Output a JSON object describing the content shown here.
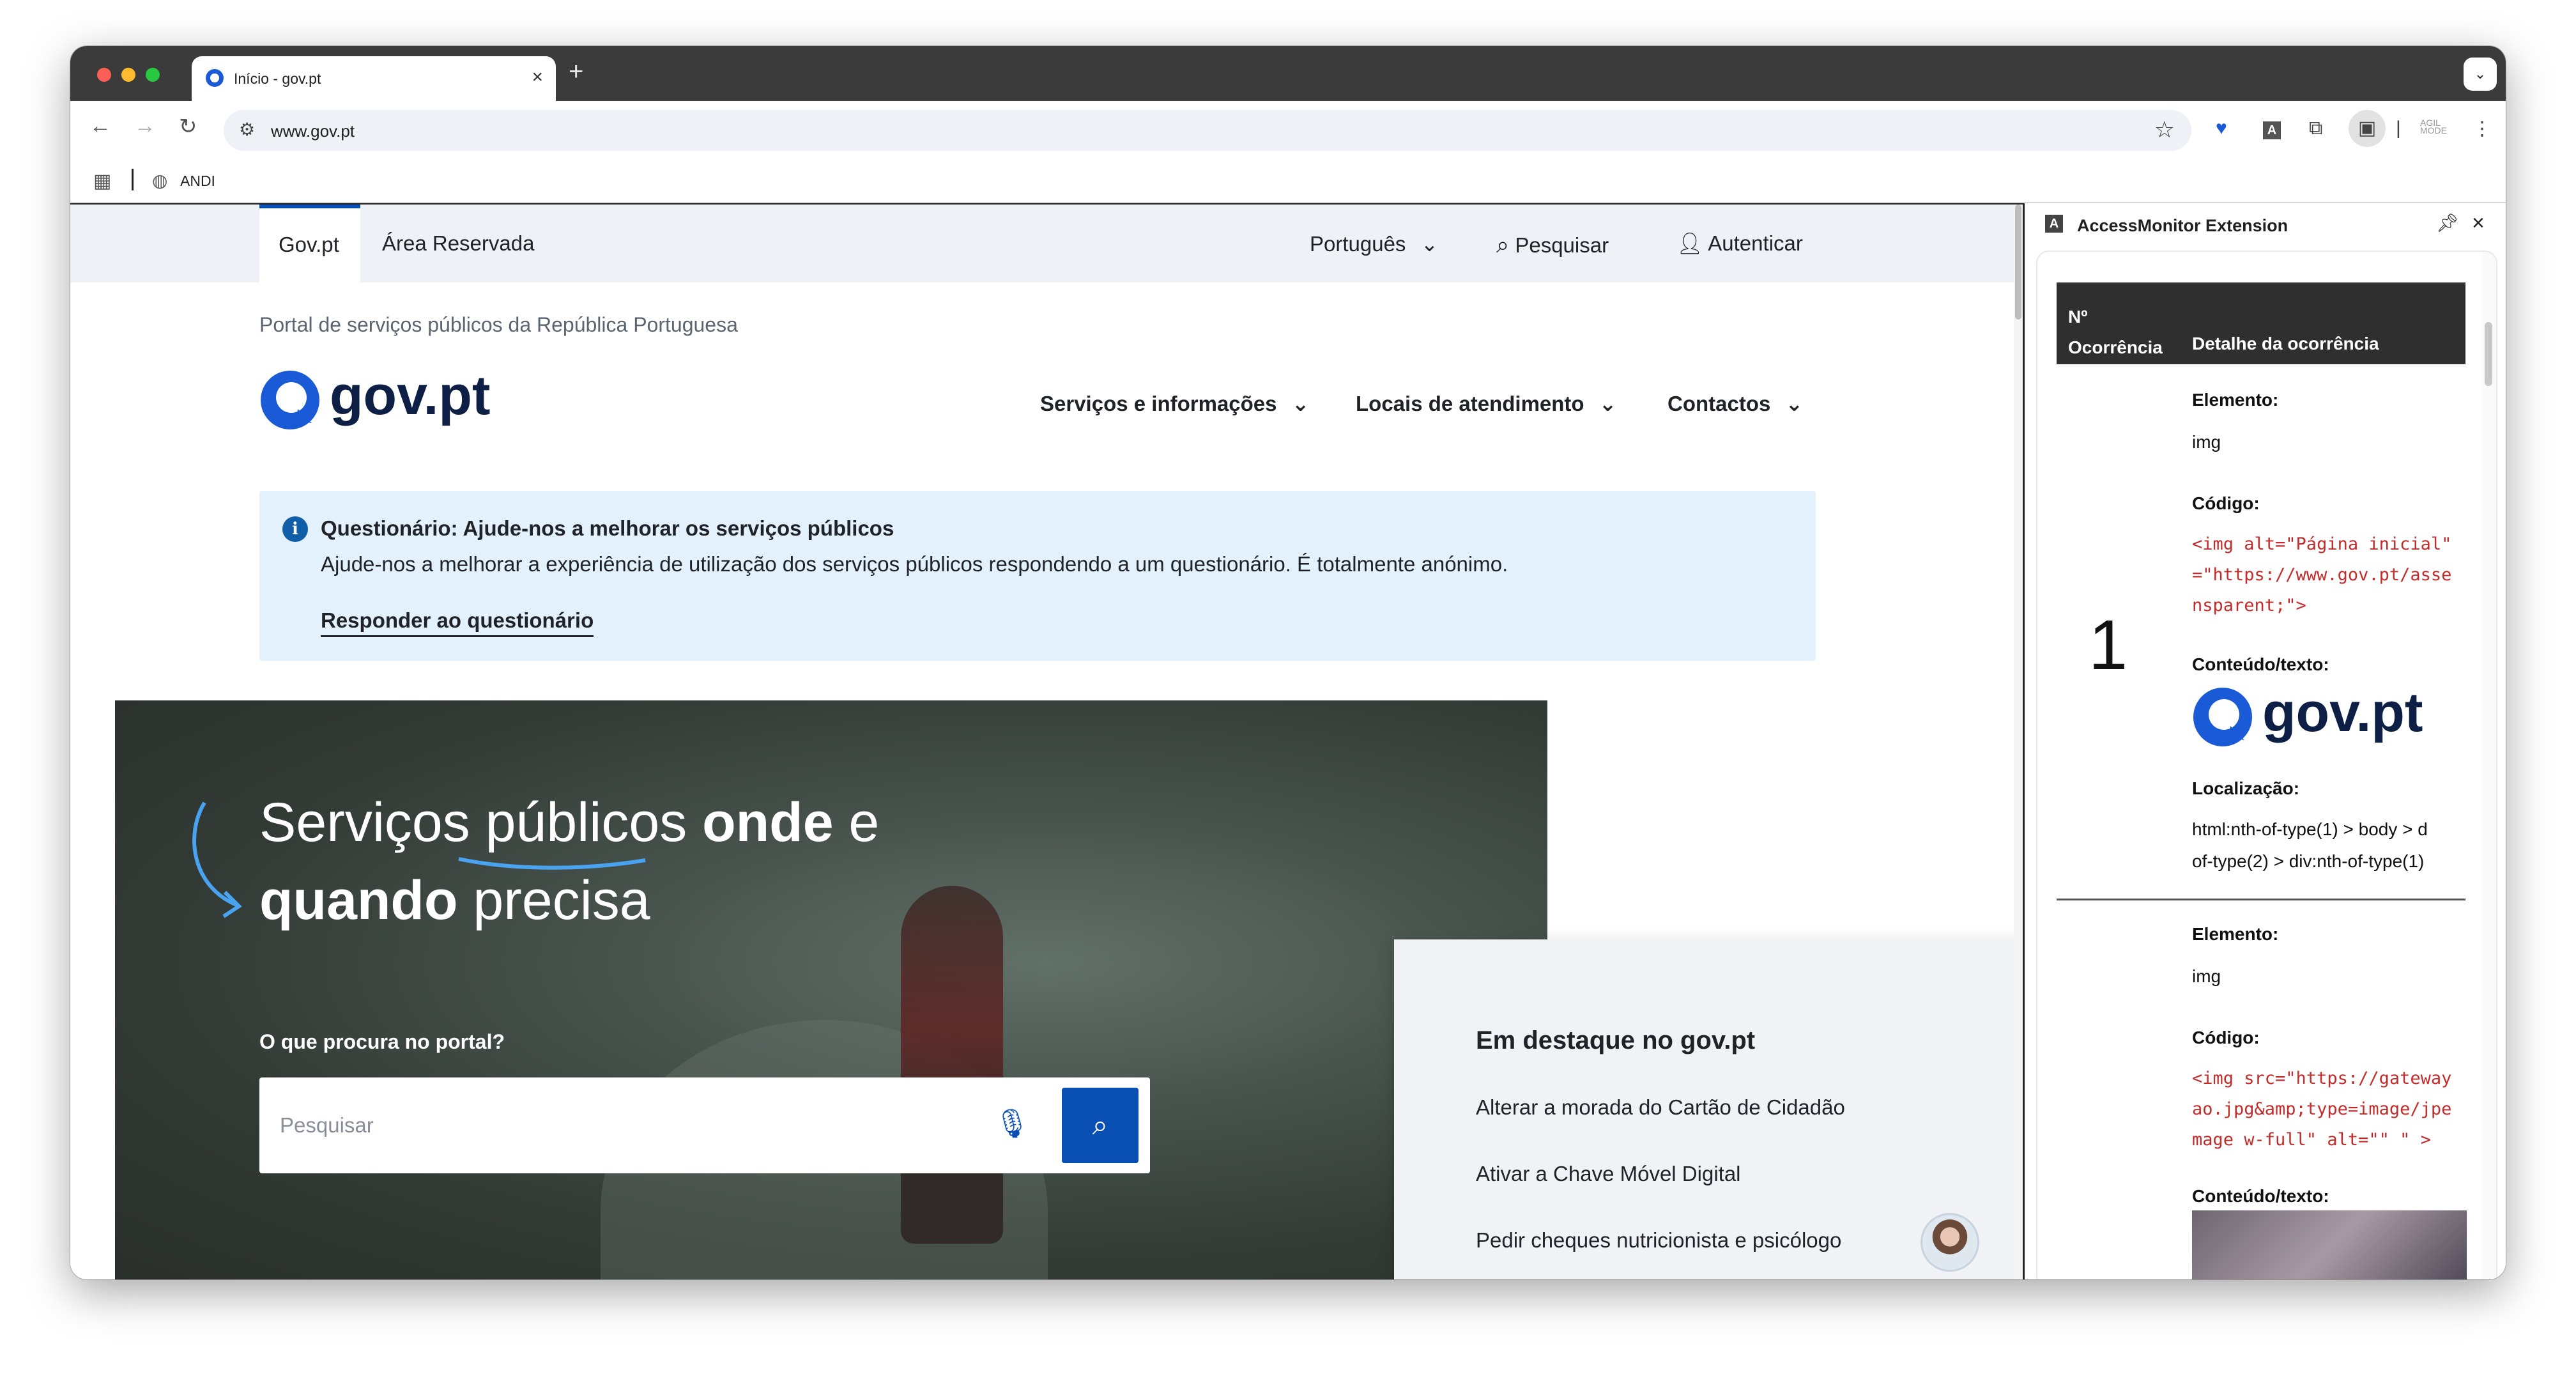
{
  "browser": {
    "tab_title": "Início - gov.pt",
    "tab_close": "×",
    "new_tab": "+",
    "tab_menu": "⌄",
    "url": "www.gov.pt",
    "bookmark": "ANDI"
  },
  "site": {
    "util_tabs": [
      "Gov.pt",
      "Área Reservada"
    ],
    "language": "Português",
    "search": "Pesquisar",
    "login": "Autenticar",
    "portal_subtitle": "Portal de serviços públicos da República Portuguesa",
    "logo_text": "gov.pt",
    "nav": [
      "Serviços e informações",
      "Locais de atendimento",
      "Contactos"
    ],
    "alert": {
      "title": "Questionário: Ajude-nos a melhorar os serviços públicos",
      "text": "Ajude-nos a melhorar a experiência de utilização dos serviços públicos respondendo a um questionário. É totalmente anónimo.",
      "link": "Responder ao questionário"
    },
    "hero": {
      "line1_a": "Serviços públicos ",
      "line1_b": "onde",
      "line1_c": " e",
      "line2_a": "quando",
      "line2_b": " precisa",
      "question": "O que procura no portal?",
      "placeholder": "Pesquisar"
    },
    "featured": {
      "title": "Em destaque no gov.pt",
      "items": [
        "Alterar a morada do Cartão de Cidadão",
        "Ativar a Chave Móvel Digital",
        "Pedir cheques nutricionista e psicólogo"
      ]
    }
  },
  "panel": {
    "title": "AccessMonitor Extension",
    "col1": "Nº\nOcorrência",
    "col2": "Detalhe da ocorrência",
    "occurrence_number": "1",
    "label_element": "Elemento:",
    "label_code": "Código:",
    "label_content": "Conteúdo/texto:",
    "label_location": "Localização:",
    "entry1": {
      "element": "img",
      "code_lines": [
        "<img alt=\"Página inicial\"",
        "=\"https://www.gov.pt/asse",
        "nsparent;\">"
      ],
      "location_lines": [
        "html:nth-of-type(1) > body > d",
        "of-type(2) > div:nth-of-type(1)"
      ]
    },
    "entry2": {
      "element": "img",
      "code_lines": [
        "<img src=\"https://gateway",
        "ao.jpg&amp;type=image/jpe",
        "mage w-full\" alt=\"\" \" >"
      ]
    }
  }
}
